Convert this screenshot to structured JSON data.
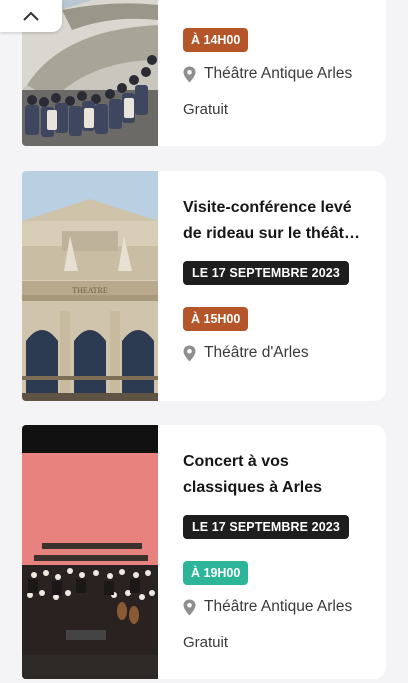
{
  "colors": {
    "orange_badge": "#b5562a",
    "teal_badge": "#2db59a",
    "date_badge": "#1e1e1e",
    "background": "#f4f4f7"
  },
  "collapse_button": {
    "icon": "chevron-up-icon"
  },
  "events": [
    {
      "title": "",
      "date": "",
      "time": "À 14H00",
      "venue": "Théâtre Antique Arles",
      "price": "Gratuit",
      "image": "ancient-theatre-crowd"
    },
    {
      "title": "Visite-conférence levé de rideau sur le théât…",
      "date": "LE 17 SEPTEMBRE 2023",
      "time": "À 15H00",
      "venue": "Théâtre d'Arles",
      "price": "",
      "image": "theatre-facade"
    },
    {
      "title": "Concert à vos classiques à Arles",
      "date": "LE 17 SEPTEMBRE 2023",
      "time": "À 19H00",
      "venue": "Théâtre Antique Arles",
      "price": "Gratuit",
      "image": "orchestra-stage"
    }
  ]
}
